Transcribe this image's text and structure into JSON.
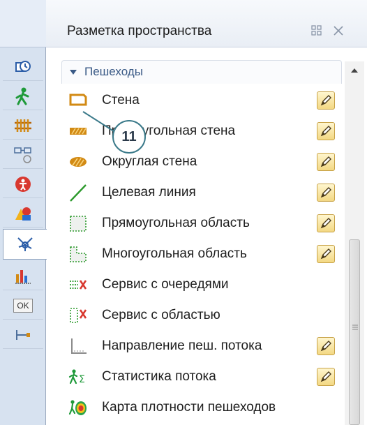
{
  "panel": {
    "title": "Разметка пространства",
    "section": "Пешеходы",
    "items": [
      {
        "label": "Стена",
        "icon": "wall-icon",
        "editable": true
      },
      {
        "label": "Прямоугольная стена",
        "icon": "rectangular-wall-icon",
        "editable": true
      },
      {
        "label": "Округлая стена",
        "icon": "round-wall-icon",
        "editable": true
      },
      {
        "label": "Целевая линия",
        "icon": "target-line-icon",
        "editable": true
      },
      {
        "label": "Прямоугольная область",
        "icon": "rectangular-area-icon",
        "editable": true
      },
      {
        "label": "Многоугольная область",
        "icon": "polygonal-area-icon",
        "editable": true
      },
      {
        "label": "Сервис с очередями",
        "icon": "service-with-queues-icon",
        "editable": false
      },
      {
        "label": "Сервис с областью",
        "icon": "service-with-area-icon",
        "editable": false
      },
      {
        "label": "Направление пеш. потока",
        "icon": "ped-flow-direction-icon",
        "editable": true
      },
      {
        "label": "Статистика потока",
        "icon": "flow-statistics-icon",
        "editable": true
      },
      {
        "label": "Карта плотности пешеходов",
        "icon": "density-map-icon",
        "editable": false
      }
    ]
  },
  "callout": {
    "number": "11"
  },
  "toolbar": {
    "tools": [
      {
        "icon": "history-icon"
      },
      {
        "icon": "pedestrian-icon"
      },
      {
        "icon": "rail-icon"
      },
      {
        "icon": "process-icon"
      },
      {
        "icon": "agent-icon"
      },
      {
        "icon": "presentation-icon"
      },
      {
        "icon": "space-markup-icon",
        "selected": true
      },
      {
        "icon": "analysis-icon"
      },
      {
        "icon": "controls-icon",
        "text": "OK"
      },
      {
        "icon": "connectivity-icon"
      }
    ]
  },
  "colors": {
    "toolbar_bg": "#d7e2f0",
    "accent": "#3a5a86",
    "wall": "#d28a14",
    "edit_button": "#f3d883"
  }
}
